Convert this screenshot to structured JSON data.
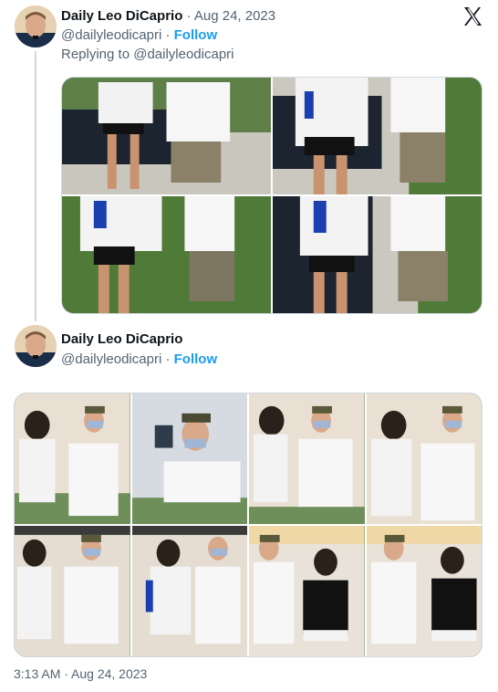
{
  "tweet1": {
    "name": "Daily Leo DiCaprio",
    "separator": "·",
    "date": "Aug 24, 2023",
    "handle": "@dailyleodicapri",
    "handle_separator": "·",
    "follow": "Follow",
    "replying": "Replying to @dailyleodicapri"
  },
  "tweet2": {
    "name": "Daily Leo DiCaprio",
    "handle": "@dailyleodicapri",
    "handle_separator": "·",
    "follow": "Follow",
    "timestamp": "3:13 AM · Aug 24, 2023"
  },
  "colors": {
    "follow": "#1d9bf0",
    "secondary_text": "#536471",
    "primary_text": "#0f1419",
    "border": "#cfd9de"
  },
  "icons": {
    "x_logo": "x-logo-icon"
  },
  "photos": {
    "grid1_count": 4,
    "grid2_count": 8
  }
}
